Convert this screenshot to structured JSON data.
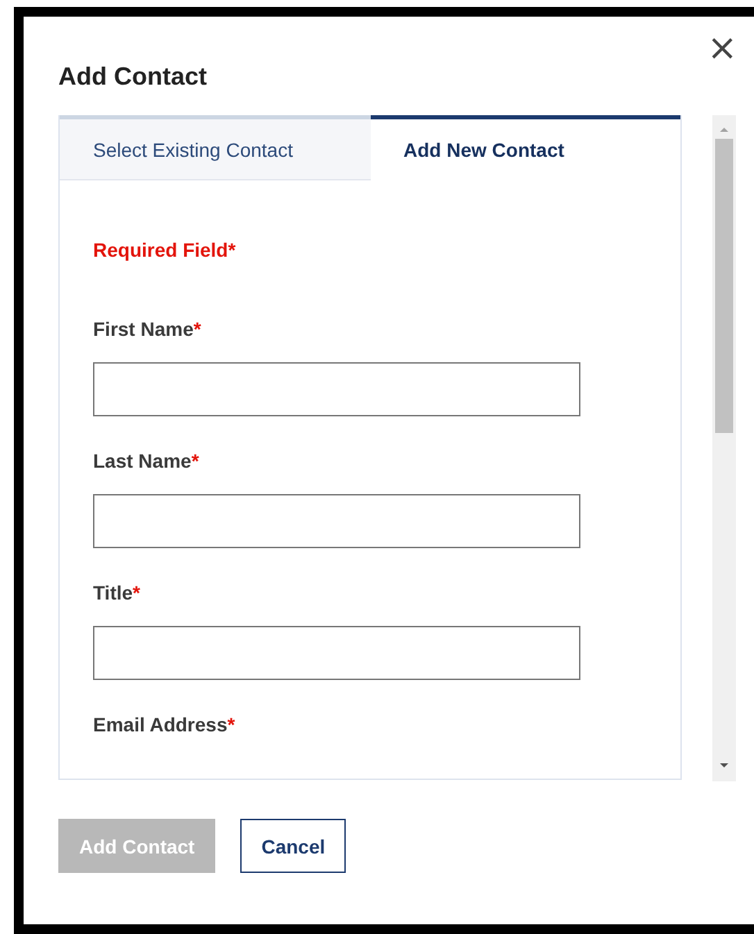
{
  "dialog": {
    "title": "Add Contact",
    "close": "×"
  },
  "tabs": [
    {
      "label": "Select Existing Contact",
      "selected": false
    },
    {
      "label": "Add New Contact",
      "selected": true
    }
  ],
  "required_note": "Required Field*",
  "fields": [
    {
      "label": "First Name",
      "required_mark": "*",
      "kind": "input"
    },
    {
      "label": "Last Name",
      "required_mark": "*",
      "kind": "input"
    },
    {
      "label": "Title",
      "required_mark": "*",
      "kind": "input"
    },
    {
      "label": "Email Address",
      "required_mark": "*",
      "kind": "label_only"
    }
  ],
  "buttons": [
    {
      "label": "Add Contact",
      "kind": "primary",
      "disabled": true
    },
    {
      "label": "Cancel",
      "kind": "secondary",
      "disabled": false
    }
  ]
}
